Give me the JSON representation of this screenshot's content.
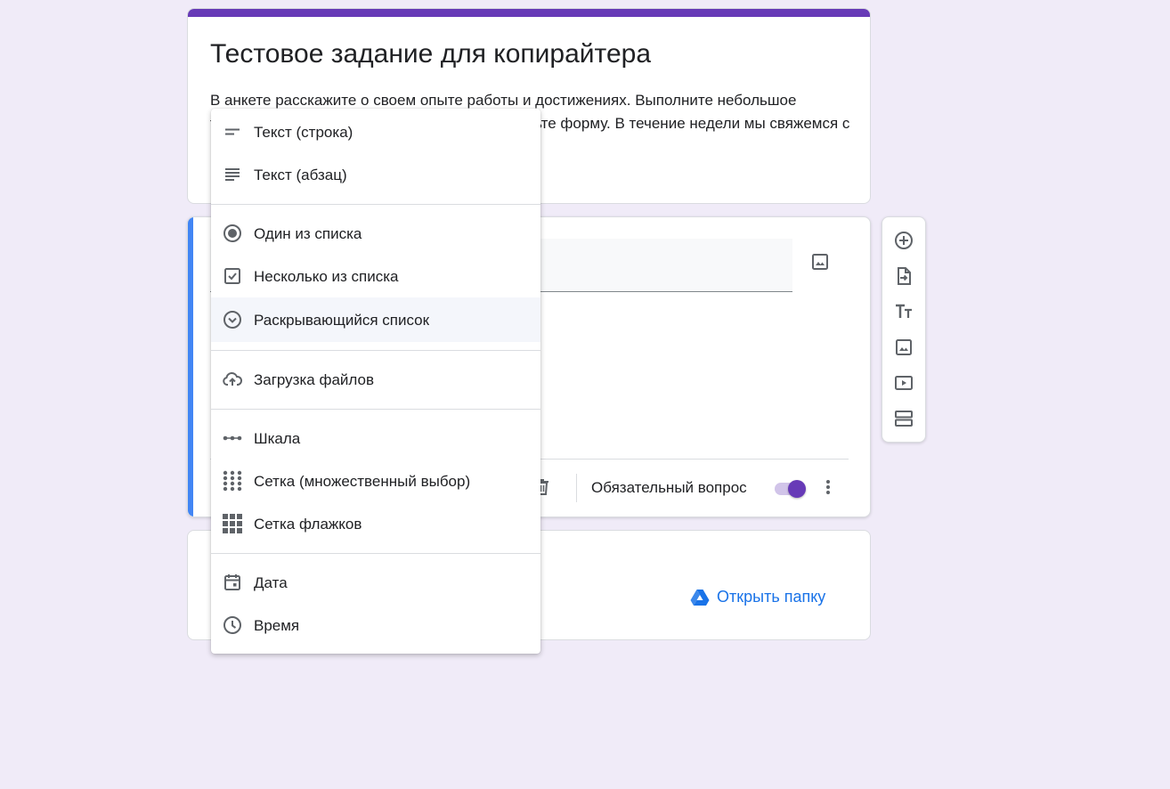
{
  "form": {
    "title": "Тестовое задание для копирайтера",
    "description": "В анкете расскажите о своем опыте работы и достижениях. Выполните небольшое тестовое задание примерно полчаса и отправьте форму. В течение недели мы свяжемся с вами вне зависимости от результата."
  },
  "question": {
    "required_label": "Обязательный вопрос",
    "required": true
  },
  "files": {
    "open_folder_label": "Открыть папку"
  },
  "type_menu": {
    "selected": "Раскрывающийся список",
    "items": [
      {
        "label": "Текст (строка)",
        "icon": "short-text-icon"
      },
      {
        "label": "Текст (абзац)",
        "icon": "paragraph-icon"
      },
      {
        "label": "Один из списка",
        "icon": "radio-button-icon"
      },
      {
        "label": "Несколько из списка",
        "icon": "checkbox-icon"
      },
      {
        "label": "Раскрывающийся список",
        "icon": "dropdown-icon"
      },
      {
        "label": "Загрузка файлов",
        "icon": "cloud-upload-icon"
      },
      {
        "label": "Шкала",
        "icon": "linear-scale-icon"
      },
      {
        "label": "Сетка (множественный выбор)",
        "icon": "grid-dots-icon"
      },
      {
        "label": "Сетка флажков",
        "icon": "grid-squares-icon"
      },
      {
        "label": "Дата",
        "icon": "calendar-icon"
      },
      {
        "label": "Время",
        "icon": "clock-icon"
      }
    ]
  },
  "toolbar": {
    "tools": [
      "add-question-icon",
      "import-questions-icon",
      "add-title-icon",
      "add-image-icon",
      "add-video-icon",
      "add-section-icon"
    ]
  },
  "colors": {
    "theme": "#673ab7",
    "accent_blue": "#4285f4",
    "link": "#1a73e8",
    "background": "#f0ebf8"
  }
}
